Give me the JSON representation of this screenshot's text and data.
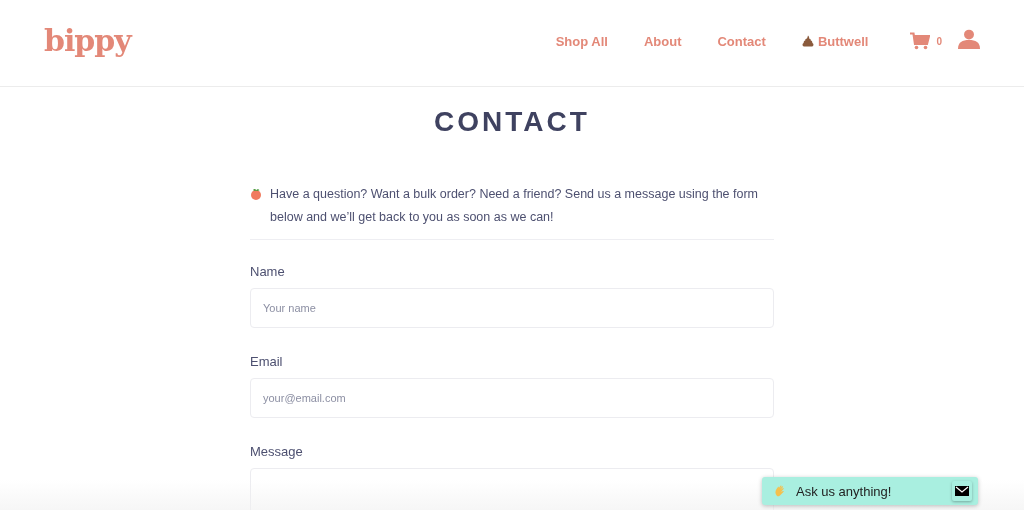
{
  "header": {
    "logo": "bippy",
    "nav": [
      {
        "label": "Shop All",
        "kind": "link"
      },
      {
        "label": "About",
        "kind": "link"
      },
      {
        "label": "Contact",
        "kind": "link"
      },
      {
        "label": "Buttwell",
        "kind": "account"
      }
    ],
    "cart_count": "0"
  },
  "page": {
    "title": "CONTACT",
    "intro": "Have a question? Want a bulk order? Need a friend? Send us a message using the form below and we’ll get back to you as soon as we can!",
    "fields": [
      {
        "label": "Name",
        "kind": "input",
        "placeholder": "Your name"
      },
      {
        "label": "Email",
        "kind": "input",
        "placeholder": "your@email.com"
      },
      {
        "label": "Message",
        "kind": "textarea"
      }
    ]
  },
  "chat": {
    "label": "Ask us anything!"
  }
}
